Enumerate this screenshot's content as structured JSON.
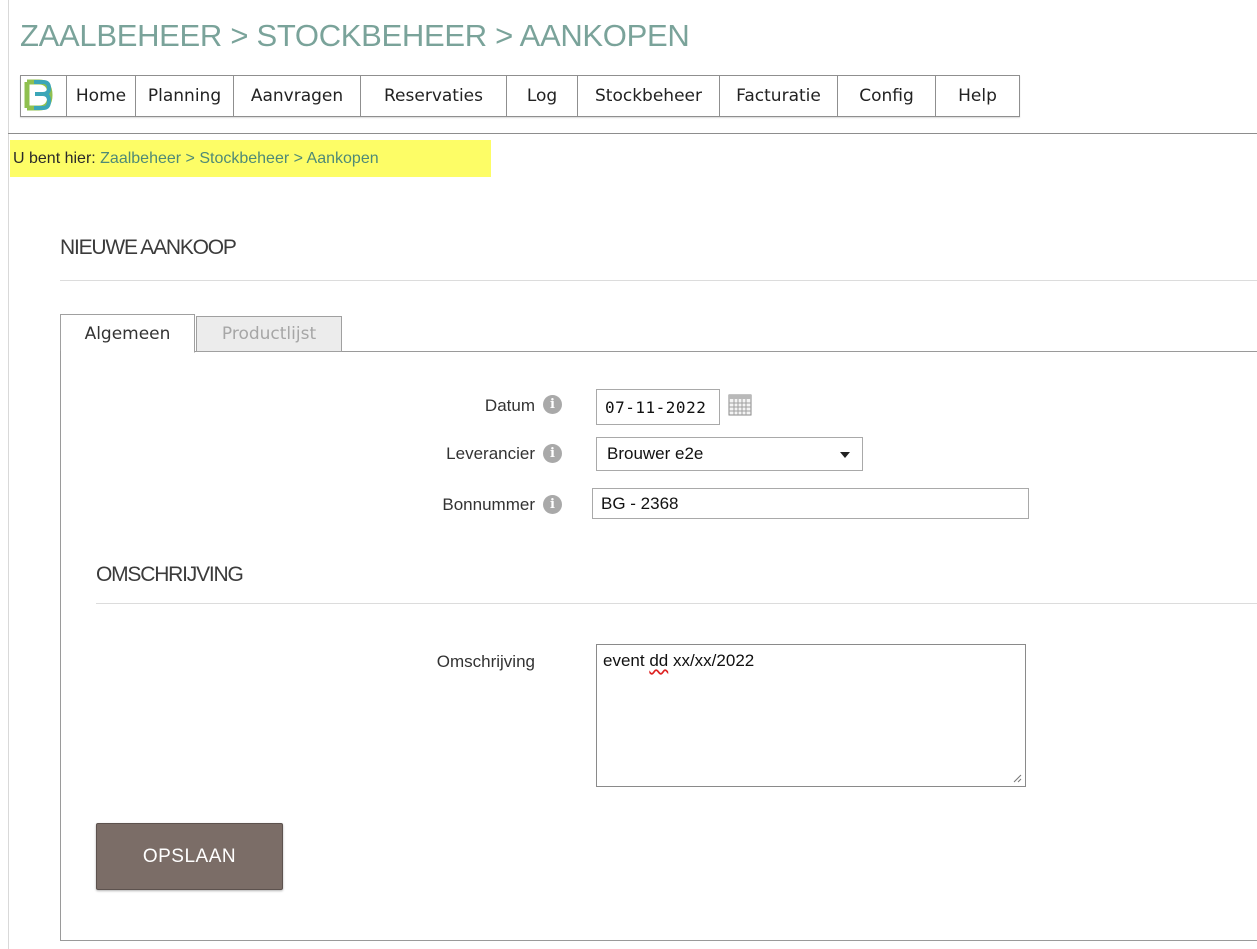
{
  "header": {
    "title": "ZAALBEHEER > STOCKBEHEER > AANKOPEN"
  },
  "nav": {
    "logo_icon": "e2e-logo-icon",
    "items": [
      "Home",
      "Planning",
      "Aanvragen",
      "Reservaties",
      "Log",
      "Stockbeheer",
      "Facturatie",
      "Config",
      "Help"
    ]
  },
  "breadcrumb": {
    "prefix": "U bent hier",
    "colon": ": ",
    "items": [
      "Zaalbeheer",
      "Stockbeheer",
      "Aankopen"
    ],
    "separator": " > "
  },
  "form": {
    "title": "NIEUWE AANKOOP",
    "tabs": [
      "Algemeen",
      "Productlijst"
    ],
    "fields": {
      "datum_label": "Datum",
      "datum_value": "07-11-2022",
      "leverancier_label": "Leverancier",
      "leverancier_value": "Brouwer e2e",
      "bonnummer_label": "Bonnummer",
      "bonnummer_value": "BG - 2368"
    },
    "description_section": "OMSCHRIJVING",
    "omschrijving_label": "Omschrijving",
    "omschrijving_value": {
      "before": "event ",
      "flagged": "dd",
      "after": " xx/xx/2022"
    },
    "save_label": "OPSLAAN"
  },
  "colors": {
    "title": "#7aa39a",
    "breadcrumb_highlight": "#fdfd66",
    "breadcrumb_link": "#4f8a76",
    "save_button": "#7b6d67"
  }
}
